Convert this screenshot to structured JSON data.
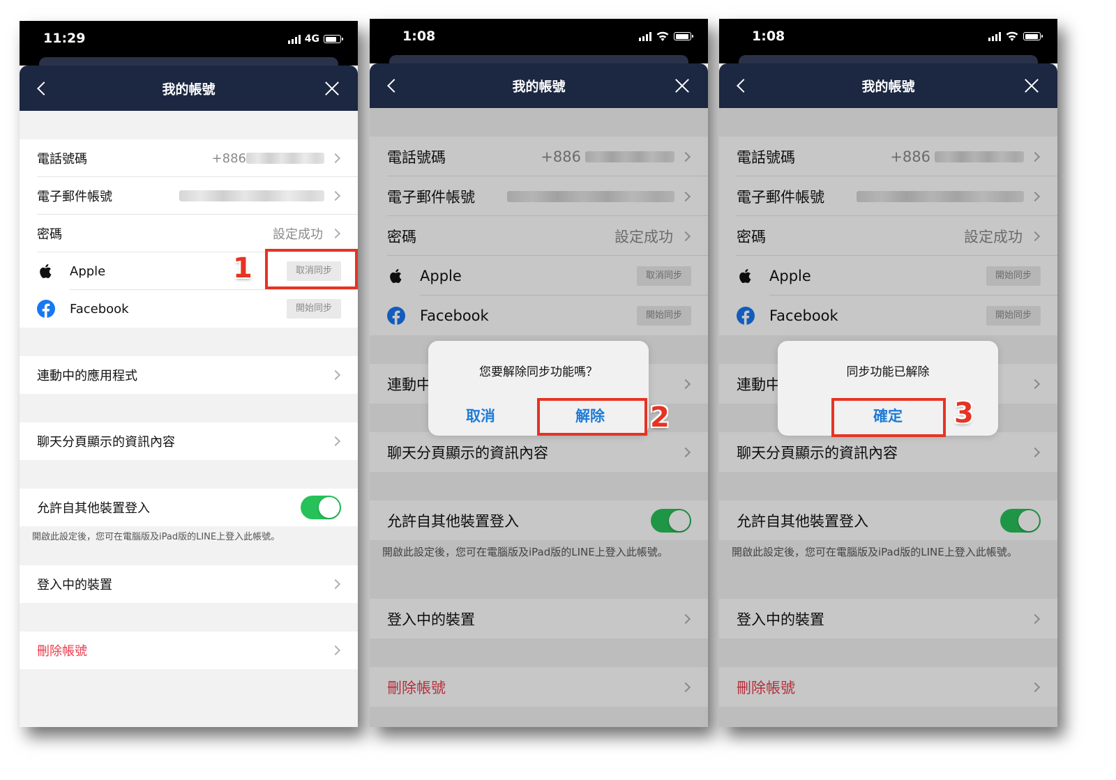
{
  "phones": [
    {
      "time": "11:29",
      "network": "4G",
      "title": "我的帳號",
      "rows": {
        "phone_label": "電話號碼",
        "phone_value": "+886",
        "email_label": "電子郵件帳號",
        "password_label": "密碼",
        "password_value": "設定成功",
        "apple_label": "Apple",
        "apple_sync": "取消同步",
        "facebook_label": "Facebook",
        "facebook_sync": "開始同步",
        "apps_label": "連動中的應用程式",
        "chat_label": "聊天分頁顯示的資訊內容",
        "allow_label": "允許自其他裝置登入",
        "allow_note": "開啟此設定後，您可在電腦版及iPad版的LINE上登入此帳號。",
        "devices_label": "登入中的裝置",
        "delete_label": "刪除帳號"
      },
      "step": "1"
    },
    {
      "time": "1:08",
      "title": "我的帳號",
      "rows": {
        "phone_label": "電話號碼",
        "phone_value": "+886",
        "email_label": "電子郵件帳號",
        "password_label": "密碼",
        "password_value": "設定成功",
        "apple_label": "Apple",
        "apple_sync": "取消同步",
        "facebook_label": "Facebook",
        "facebook_sync": "開始同步",
        "apps_label": "連動中",
        "chat_label": "聊天分頁顯示的資訊內容",
        "allow_label": "允許自其他裝置登入",
        "allow_note": "開啟此設定後，您可在電腦版及iPad版的LINE上登入此帳號。",
        "devices_label": "登入中的裝置",
        "delete_label": "刪除帳號"
      },
      "dialog": {
        "message": "您要解除同步功能嗎？",
        "cancel": "取消",
        "confirm": "解除"
      },
      "step": "2"
    },
    {
      "time": "1:08",
      "title": "我的帳號",
      "rows": {
        "phone_label": "電話號碼",
        "phone_value": "+886",
        "email_label": "電子郵件帳號",
        "password_label": "密碼",
        "password_value": "設定成功",
        "apple_label": "Apple",
        "apple_sync": "開始同步",
        "facebook_label": "Facebook",
        "facebook_sync": "開始同步",
        "apps_label": "連動中",
        "chat_label": "聊天分頁顯示的資訊內容",
        "allow_label": "允許自其他裝置登入",
        "allow_note": "開啟此設定後，您可在電腦版及iPad版的LINE上登入此帳號。",
        "devices_label": "登入中的裝置",
        "delete_label": "刪除帳號"
      },
      "dialog": {
        "message": "同步功能已解除",
        "confirm": "確定"
      },
      "step": "3"
    }
  ],
  "colors": {
    "navbar": "#1c2742",
    "toggle_on": "#27c15a",
    "danger": "#e83b4c",
    "highlight": "#e63323",
    "dialog_button": "#1f7bd6"
  },
  "toggles": {
    "allow_other_devices": true
  }
}
